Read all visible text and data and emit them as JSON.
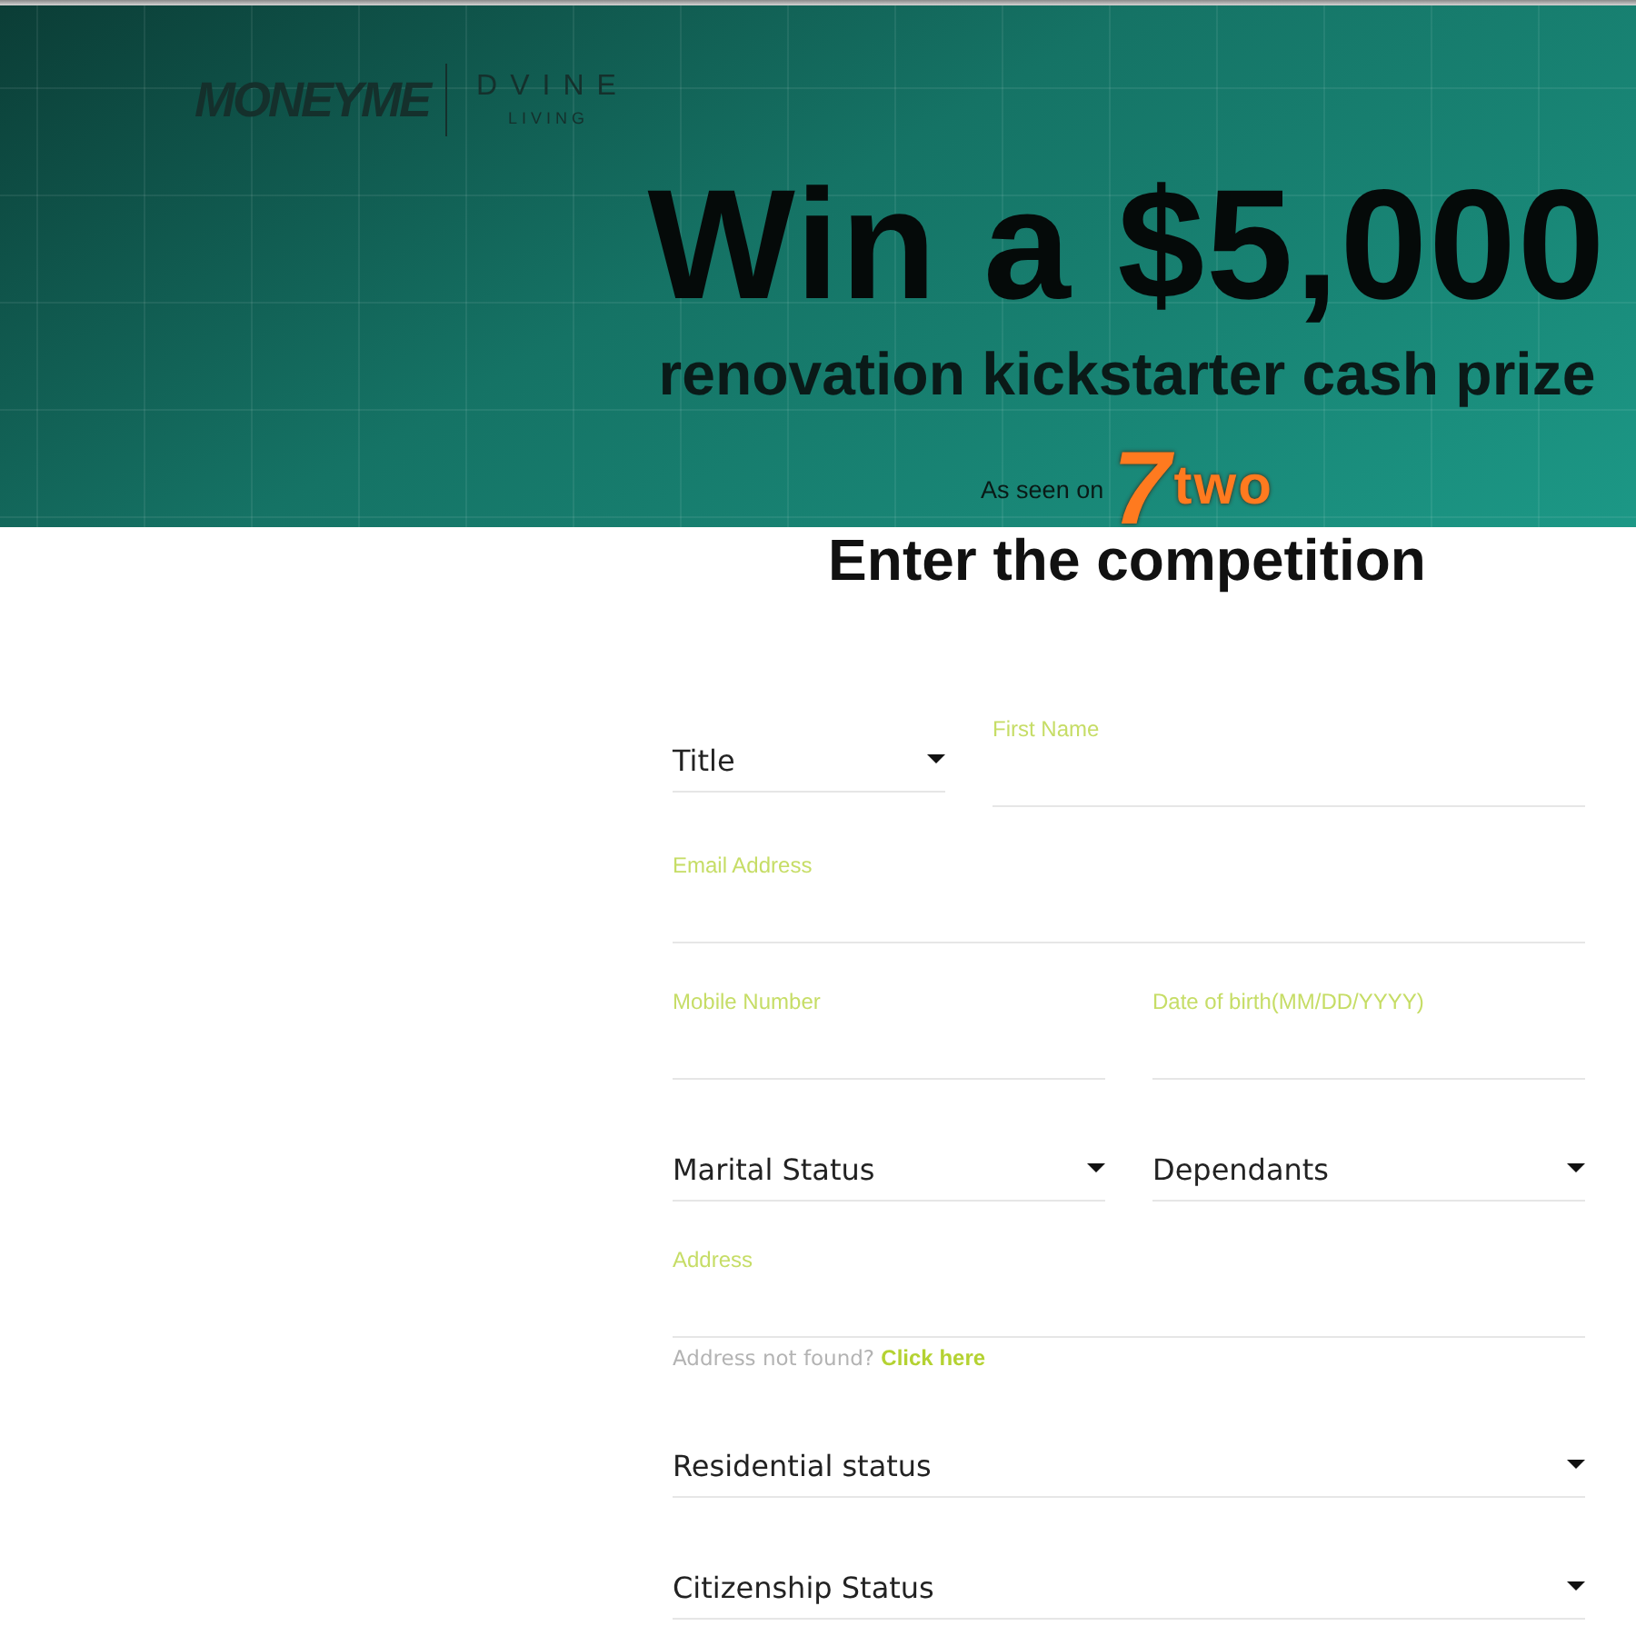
{
  "banner": {
    "brand_logo": "MONEYME",
    "partner_logo": {
      "name": "DVINE",
      "tagline": "LIVING"
    },
    "headline": "Win a $5,000",
    "subheadline": "renovation kickstarter cash prize",
    "as_seen_on": {
      "text": "As seen on",
      "channel_numeral": "7",
      "channel_name": "two"
    }
  },
  "heading": "Enter the competition",
  "form": {
    "rows": [
      [
        {
          "kind": "select",
          "label": "Title"
        },
        {
          "kind": "text",
          "label": "First Name"
        }
      ],
      [
        {
          "kind": "text",
          "label": "Email Address"
        }
      ],
      [
        {
          "kind": "text",
          "label": "Mobile Number"
        },
        {
          "kind": "text",
          "label": "Date of birth(MM/DD/YYYY)"
        }
      ],
      [
        {
          "kind": "select",
          "label": "Marital Status"
        },
        {
          "kind": "select",
          "label": "Dependants"
        }
      ],
      [
        {
          "kind": "text",
          "label": "Address",
          "hint": {
            "text": "Address not found?",
            "link": "Click here"
          }
        }
      ],
      [
        {
          "kind": "select",
          "label": "Residential status"
        }
      ],
      [
        {
          "kind": "select",
          "label": "Citizenship Status"
        }
      ]
    ]
  }
}
